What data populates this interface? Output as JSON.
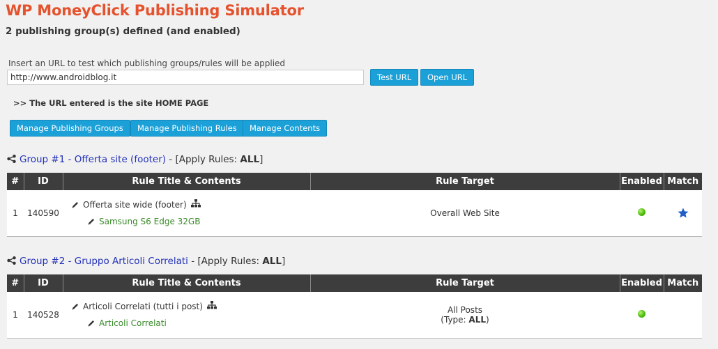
{
  "header": {
    "title": "WP MoneyClick Publishing Simulator",
    "subtitle": "2 publishing group(s) defined (and enabled)"
  },
  "url_test": {
    "label": "Insert an URL to test which publishing groups/rules will be applied",
    "value": "http://www.androidblog.it",
    "test_button": "Test URL",
    "open_button": "Open URL",
    "result_notice": ">> The URL entered is the site HOME PAGE"
  },
  "manage_buttons": {
    "groups": "Manage Publishing Groups",
    "rules": "Manage Publishing Rules",
    "contents": "Manage Contents"
  },
  "table_headers": {
    "num": "#",
    "id": "ID",
    "title": "Rule Title & Contents",
    "target": "Rule Target",
    "enabled": "Enabled",
    "match": "Match"
  },
  "groups": [
    {
      "link_text": "Group #1 - Offerta site (footer)",
      "apply_prefix": " - [Apply Rules: ",
      "apply_value": "ALL",
      "apply_suffix": "]",
      "rows": [
        {
          "num": "1",
          "id": "140590",
          "rule_title": "Offerta site wide (footer)",
          "content": "Samsung S6 Edge 32GB",
          "target_main": "Overall Web Site",
          "target_type_prefix": "",
          "target_type_value": "",
          "target_type_suffix": "",
          "enabled": true,
          "match": true
        }
      ]
    },
    {
      "link_text": "Group #2 - Gruppo Articoli Correlati",
      "apply_prefix": " - [Apply Rules: ",
      "apply_value": "ALL",
      "apply_suffix": "]",
      "rows": [
        {
          "num": "1",
          "id": "140528",
          "rule_title": "Articoli Correlati (tutti i post)",
          "content": "Articoli Correlati",
          "target_main": "All Posts",
          "target_type_prefix": "(Type: ",
          "target_type_value": "ALL",
          "target_type_suffix": ")",
          "enabled": true,
          "match": false
        }
      ]
    }
  ],
  "icons": {
    "share": "share-icon",
    "edit": "pencil-icon",
    "hierarchy": "sitemap-icon",
    "enabled": "green-dot-icon",
    "match": "star-icon"
  },
  "colors": {
    "title": "#e4532e",
    "button": "#1ba0d8",
    "link": "#2332b8",
    "content": "#3a8a2a",
    "table_header": "#3d3d3d",
    "star": "#1f5fc7"
  }
}
